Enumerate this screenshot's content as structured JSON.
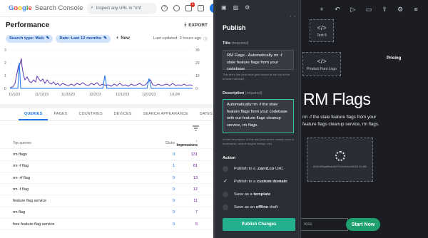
{
  "gsc": {
    "brand_google": [
      "G",
      "o",
      "o",
      "g",
      "l",
      "e"
    ],
    "brand_product": "Search Console",
    "search_placeholder": "Inspect any URL in \"rmf",
    "notif_count": "1",
    "avatar_letter": "B",
    "page_title": "Performance",
    "export_label": "EXPORT",
    "filter_search_type": "Search type: Web",
    "filter_date": "Date: Last 12 months",
    "new_label": "New",
    "last_updated": "Last updated: 3 hours ago",
    "chart": {
      "y_left_ticks": [
        "3",
        "2",
        "1",
        "0"
      ],
      "y_right_ticks": [
        "30",
        "20",
        "10",
        "0"
      ],
      "x_ticks": [
        "11/1/23",
        "11/12/23",
        "11/22/23",
        "12/2/23",
        "12/12/23",
        "12/22/23",
        "1/1/24"
      ],
      "clicks_color": "#1a73e8",
      "impressions_color": "#5e35b1"
    },
    "tabs": [
      "QUERIES",
      "PAGES",
      "COUNTRIES",
      "DEVICES",
      "SEARCH APPEARANCE",
      "DATES"
    ],
    "table": {
      "headers": {
        "query": "Top queries",
        "clicks": "Clicks",
        "impressions": "Impressions"
      },
      "rows": [
        {
          "query": "rm flags",
          "clicks": "0",
          "impressions": "131"
        },
        {
          "query": "rm -f flag",
          "clicks": "1",
          "impressions": "81"
        },
        {
          "query": "rm -rf flag",
          "clicks": "0",
          "impressions": "13"
        },
        {
          "query": "rm -f flag",
          "clicks": "0",
          "impressions": "12"
        },
        {
          "query": "feature flag service",
          "clicks": "0",
          "impressions": "11"
        },
        {
          "query": "rm flag",
          "clicks": "0",
          "impressions": "7"
        },
        {
          "query": "free feature flag service",
          "clicks": "0",
          "impressions": "5"
        }
      ]
    }
  },
  "panel": {
    "title": "Publish",
    "title_label": "Title",
    "title_required": "(required)",
    "title_value": "RM Flags - Automatically rm -f stale feature flags from your codebase",
    "title_help": "This site's title (and what gets shown at the top of the browser window).",
    "desc_label": "Description",
    "desc_required": "(required)",
    "desc_value": "Automatically rm -f the stale feature flags from your codebase with our feature flags cleanup service, rm flags.",
    "desc_help": "A brief description of this site (and what's usually used in bookmarks, search engine listings, etc).",
    "action_label": "Action",
    "options": [
      {
        "pre": "Publish to a ",
        "emph": ".carrd.co",
        "post": " URL",
        "checked": false
      },
      {
        "pre": "Publish to a ",
        "emph": "custom domain",
        "post": "",
        "checked": true
      },
      {
        "pre": "Save as a ",
        "emph": "template",
        "post": "",
        "checked": false
      },
      {
        "pre": "Save as an ",
        "emph": "offline",
        "post": " draft",
        "checked": false
      }
    ],
    "publish_button": "Publish Changes"
  },
  "canvas": {
    "ph_text_label": "Text 8",
    "ph_logo_label": "Product Hunt Logo",
    "pricing": "Pricing",
    "hero": "RM Flags",
    "hero_desc": "rm -f the stale feature flags from your feature flags cleanup service, rm flags.",
    "loader_id": "8154489aaf9a4d4207e10eb4e2b5-8113-450",
    "email_placeholder": "ress",
    "start_button": "Start Now"
  }
}
